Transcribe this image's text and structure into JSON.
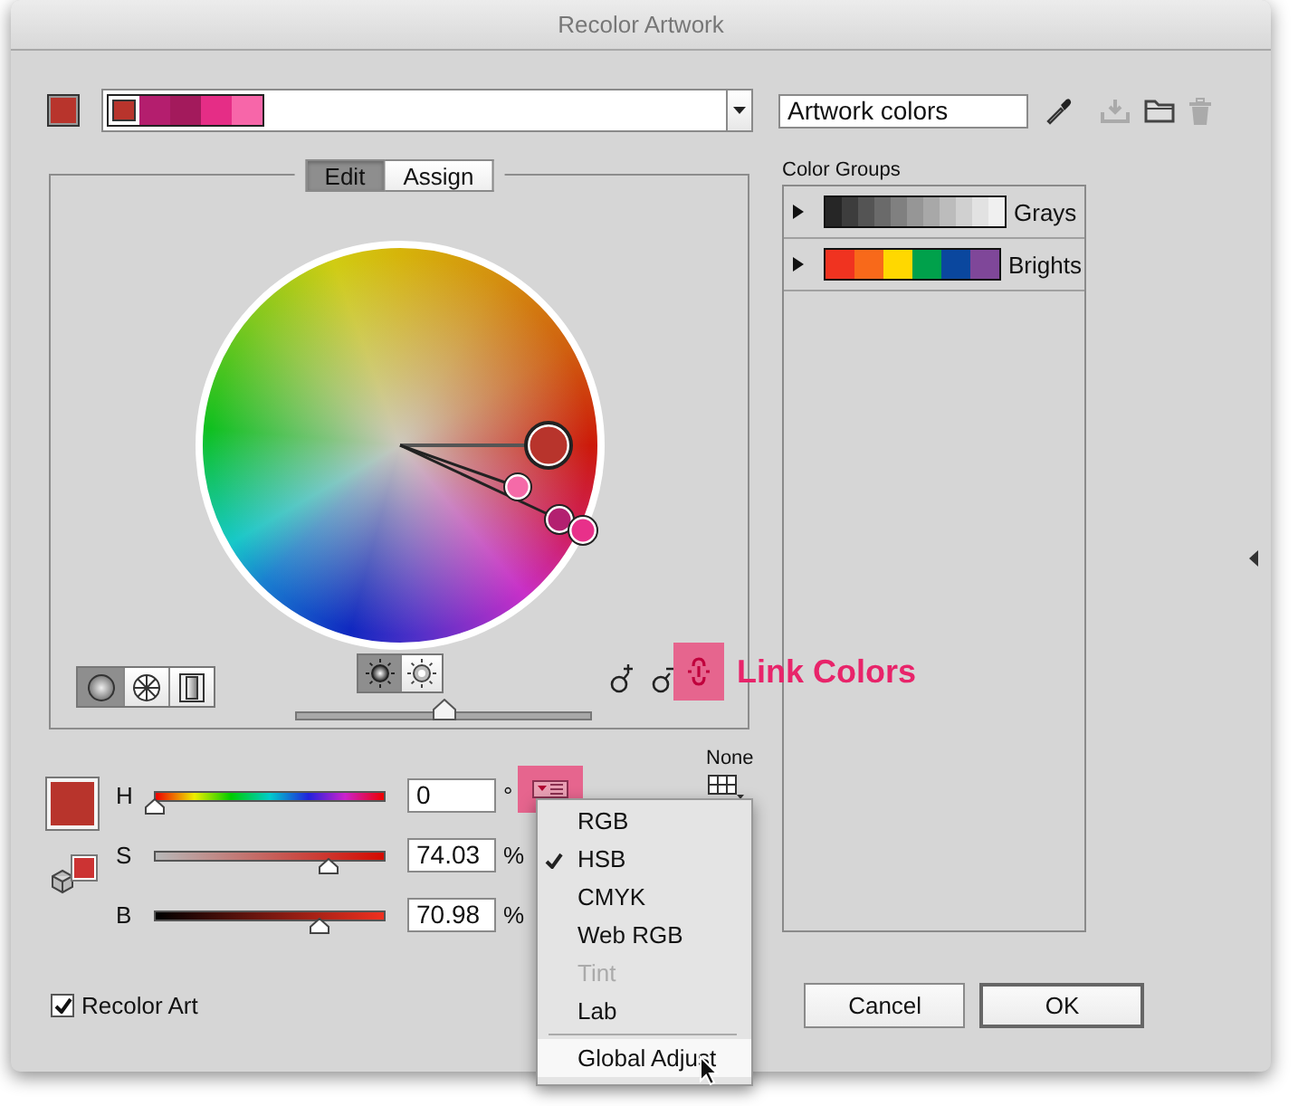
{
  "window": {
    "title": "Recolor Artwork"
  },
  "active_color": {
    "color": "#b8342c"
  },
  "harmony": {
    "swatches": [
      {
        "color": "#b8342c",
        "base": true
      },
      {
        "color": "#b41e6e",
        "base": false
      },
      {
        "color": "#a31a5c",
        "base": false
      },
      {
        "color": "#e52d86",
        "base": false
      },
      {
        "color": "#f766a9",
        "base": false
      }
    ]
  },
  "color_group_name": {
    "value": "Artwork colors"
  },
  "tabs": [
    {
      "label": "Edit",
      "selected": true
    },
    {
      "label": "Assign",
      "selected": false
    }
  ],
  "wheel": {
    "markers": [
      {
        "color": "#b8342c",
        "base": true
      },
      {
        "color": "#f56aa8",
        "base": false
      },
      {
        "color": "#b32070",
        "base": false
      },
      {
        "color": "#e8308a",
        "base": false
      }
    ]
  },
  "wheel_modes": [
    {
      "kind": "smooth",
      "selected": true
    },
    {
      "kind": "segmented",
      "selected": false
    },
    {
      "kind": "bars",
      "selected": false
    }
  ],
  "brightness_modes": [
    {
      "kind": "brightness",
      "selected": true
    },
    {
      "kind": "saturation",
      "selected": false
    }
  ],
  "brightness_slider": {
    "level": 0.5
  },
  "link_colors": {
    "label": "Link Colors"
  },
  "color_groups": {
    "title": "Color Groups",
    "groups": [
      {
        "name": "Grays",
        "expanded": false,
        "swatches": [
          {
            "color": "#262626"
          },
          {
            "color": "#3d3d3d"
          },
          {
            "color": "#545454"
          },
          {
            "color": "#6a6a6a"
          },
          {
            "color": "#808080"
          },
          {
            "color": "#969696"
          },
          {
            "color": "#a8a8a8"
          },
          {
            "color": "#bcbcbc"
          },
          {
            "color": "#d0d0d0"
          },
          {
            "color": "#e2e2e2"
          },
          {
            "color": "#f0f0f0"
          }
        ]
      },
      {
        "name": "Brights",
        "expanded": false,
        "swatches": [
          {
            "color": "#f03320"
          },
          {
            "color": "#f8691a"
          },
          {
            "color": "#ffd800"
          },
          {
            "color": "#00a14b"
          },
          {
            "color": "#0a479e"
          },
          {
            "color": "#7f4799"
          }
        ]
      }
    ]
  },
  "current_color": {
    "color": "#b8342c"
  },
  "web_color": {
    "color": "#cc3333"
  },
  "channels": [
    {
      "kind": "hue",
      "label": "H",
      "value": "0",
      "unit": "°",
      "level": 0
    },
    {
      "kind": "saturation",
      "label": "S",
      "value": "74.03",
      "unit": "%",
      "level": 0.75
    },
    {
      "kind": "brightness",
      "label": "B",
      "value": "70.98",
      "unit": "%",
      "level": 0.71
    }
  ],
  "color_reduction": {
    "label": "None"
  },
  "mode_menu": {
    "items": [
      {
        "label": "RGB",
        "checked": false,
        "disabled": false,
        "selected": false
      },
      {
        "label": "HSB",
        "checked": true,
        "disabled": false,
        "selected": false
      },
      {
        "label": "CMYK",
        "checked": false,
        "disabled": false,
        "selected": false
      },
      {
        "label": "Web RGB",
        "checked": false,
        "disabled": false,
        "selected": false
      },
      {
        "label": "Tint",
        "checked": false,
        "disabled": true,
        "selected": false
      },
      {
        "label": "Lab",
        "checked": false,
        "disabled": false,
        "selected": false
      },
      {
        "label": "Global Adjust",
        "checked": false,
        "disabled": false,
        "selected": true
      }
    ]
  },
  "recolor_art": {
    "label": "Recolor Art",
    "checked": true
  },
  "buttons": [
    {
      "label": "Cancel",
      "default": false
    },
    {
      "label": "OK",
      "default": true
    }
  ]
}
